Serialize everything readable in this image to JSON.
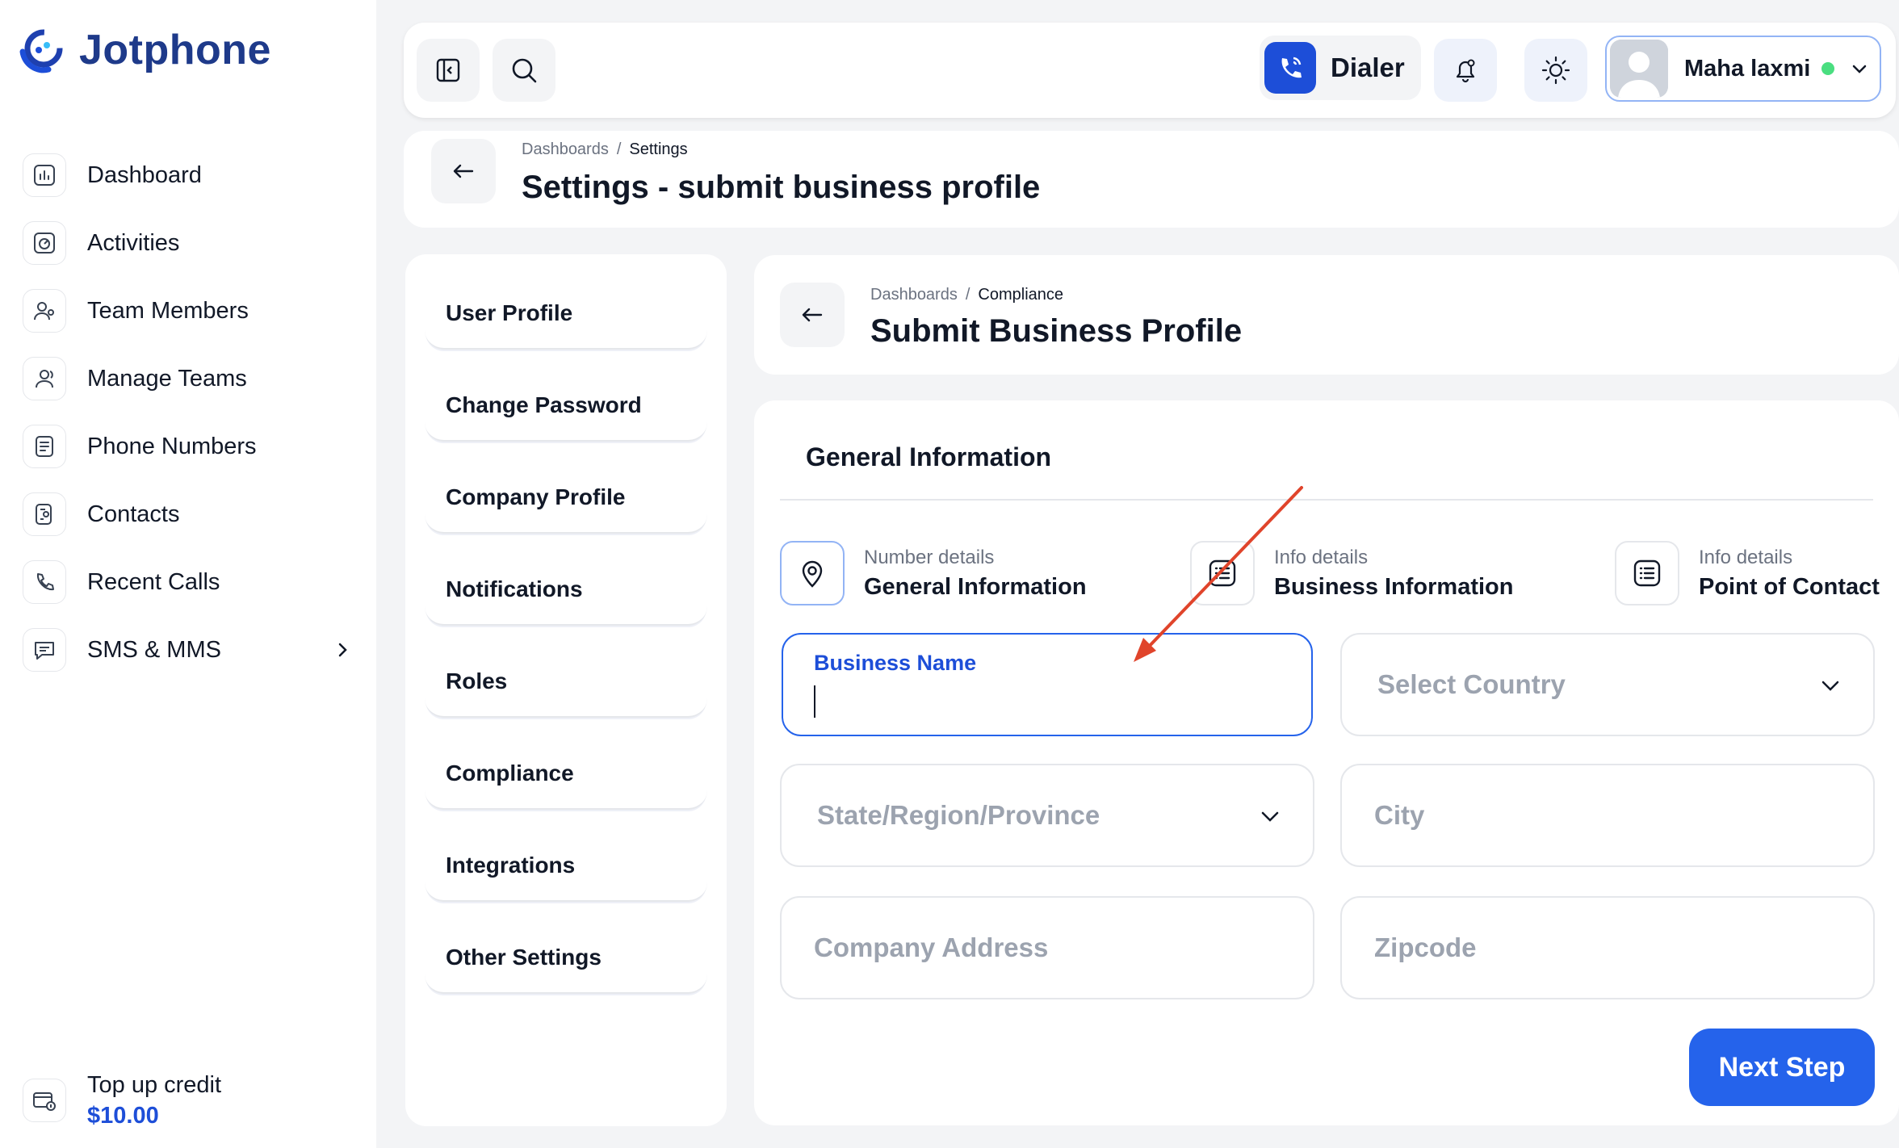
{
  "brand": {
    "name": "Jotphone"
  },
  "sidebar": {
    "items": [
      {
        "label": "Dashboard",
        "icon": "chart-icon"
      },
      {
        "label": "Activities",
        "icon": "activity-icon"
      },
      {
        "label": "Team Members",
        "icon": "team-members-icon"
      },
      {
        "label": "Manage Teams",
        "icon": "manage-teams-icon"
      },
      {
        "label": "Phone Numbers",
        "icon": "phone-numbers-icon"
      },
      {
        "label": "Contacts",
        "icon": "contacts-icon"
      },
      {
        "label": "Recent Calls",
        "icon": "recent-calls-icon"
      },
      {
        "label": "SMS & MMS",
        "icon": "sms-icon"
      }
    ],
    "topup": {
      "label": "Top up credit",
      "value": "$10.00"
    }
  },
  "topbar": {
    "dialer_label": "Dialer",
    "user_name": "Maha laxmi",
    "status_color": "#4ade80"
  },
  "page_header": {
    "breadcrumb": [
      "Dashboards",
      "/",
      "Settings"
    ],
    "title": "Settings - submit business profile"
  },
  "settings_menu": {
    "items": [
      "User Profile",
      "Change Password",
      "Company Profile",
      "Notifications",
      "Roles",
      "Compliance",
      "Integrations",
      "Other Settings"
    ]
  },
  "content": {
    "breadcrumb": [
      "Dashboards",
      "/",
      "Compliance"
    ],
    "title": "Submit Business Profile",
    "section_title": "General Information",
    "steps": [
      {
        "sub": "Number details",
        "main": "General Information"
      },
      {
        "sub": "Info details",
        "main": "Business Information"
      },
      {
        "sub": "Info details",
        "main": "Point of Contact"
      }
    ],
    "fields": {
      "business_name_label": "Business Name",
      "business_name_value": "",
      "country_placeholder": "Select Country",
      "state_placeholder": "State/Region/Province",
      "city_placeholder": "City",
      "address_placeholder": "Company Address",
      "zip_placeholder": "Zipcode"
    },
    "next_button": "Next Step"
  },
  "colors": {
    "accent": "#2563eb",
    "brand": "#1e3a8a",
    "annotation_arrow": "#e0442b"
  }
}
